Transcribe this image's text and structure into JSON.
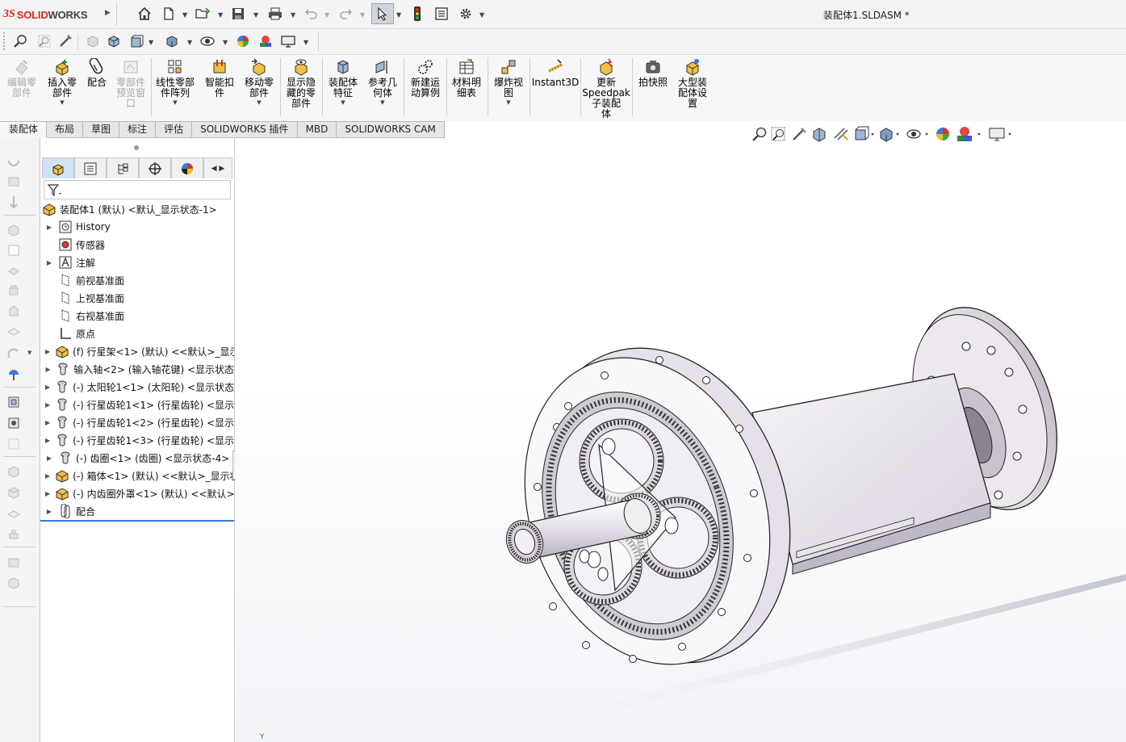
{
  "app": {
    "logo_ds": "3S",
    "logo_solid": "SOLID",
    "logo_works": "WORKS",
    "document_title": "装配体1.SLDASM *"
  },
  "colors": {
    "accent": "#d52b1e",
    "selection_blue": "#cfe3f5",
    "part_yellow": "#e8b830"
  },
  "titlebar_icons": [
    "home-icon",
    "new-file-icon",
    "open-file-icon",
    "save-icon",
    "print-icon",
    "undo-icon",
    "redo-icon",
    "select-arrow-icon",
    "traffic-light-icon",
    "file-properties-icon",
    "options-gear-icon"
  ],
  "viewbar_icons": [
    "zoom-to-fit-icon",
    "zoom-area-icon",
    "previous-view-icon",
    "section-view-icon",
    "view-orientation-icon",
    "display-style-icon",
    "hide-show-icon",
    "appearance-icon",
    "scene-icon",
    "view-settings-icon"
  ],
  "command_manager": [
    {
      "label": "编辑零\n部件",
      "disabled": true,
      "icon": "edit-component-icon"
    },
    {
      "label": "插入零\n部件",
      "disabled": false,
      "icon": "insert-component-icon"
    },
    {
      "label": "配合",
      "disabled": false,
      "icon": "mate-icon"
    },
    {
      "label": "零部件\n预览窗\n口",
      "disabled": true,
      "icon": "component-preview-icon"
    },
    {
      "label": "线性零部\n件阵列",
      "disabled": false,
      "icon": "linear-pattern-icon"
    },
    {
      "label": "智能扣\n件",
      "disabled": false,
      "icon": "smart-fasteners-icon"
    },
    {
      "label": "移动零\n部件",
      "disabled": false,
      "icon": "move-component-icon"
    },
    {
      "label": "显示隐\n藏的零\n部件",
      "disabled": false,
      "icon": "show-hidden-icon"
    },
    {
      "label": "装配体\n特征",
      "disabled": false,
      "icon": "assembly-features-icon"
    },
    {
      "label": "参考几\n何体",
      "disabled": false,
      "icon": "reference-geometry-icon"
    },
    {
      "label": "新建运\n动算例",
      "disabled": false,
      "icon": "motion-study-icon"
    },
    {
      "label": "材料明\n细表",
      "disabled": false,
      "icon": "bill-of-materials-icon"
    },
    {
      "label": "爆炸视\n图",
      "disabled": false,
      "icon": "exploded-view-icon"
    },
    {
      "label": "Instant3D",
      "disabled": false,
      "icon": "instant3d-icon"
    },
    {
      "label": "更新\nSpeedpak\n子装配\n体",
      "disabled": false,
      "icon": "speedpak-icon"
    },
    {
      "label": "拍快照",
      "disabled": false,
      "icon": "snapshot-icon"
    },
    {
      "label": "大型装\n配体设\n置",
      "disabled": false,
      "icon": "large-assembly-icon"
    }
  ],
  "tabs": [
    "装配体",
    "布局",
    "草图",
    "标注",
    "评估",
    "SOLIDWORKS 插件",
    "MBD",
    "SOLIDWORKS CAM"
  ],
  "active_tab": "装配体",
  "feature_tree": {
    "root": "装配体1 (默认) <默认_显示状态-1>",
    "items": [
      {
        "label": "History",
        "icon": "history-icon",
        "expand": true
      },
      {
        "label": "传感器",
        "icon": "sensor-icon",
        "expand": false
      },
      {
        "label": "注解",
        "icon": "annotation-icon",
        "expand": true
      },
      {
        "label": "前视基准面",
        "icon": "plane-icon",
        "expand": false
      },
      {
        "label": "上视基准面",
        "icon": "plane-icon",
        "expand": false
      },
      {
        "label": "右视基准面",
        "icon": "plane-icon",
        "expand": false
      },
      {
        "label": "原点",
        "icon": "origin-icon",
        "expand": false
      },
      {
        "label": "(f) 行星架<1> (默认) <<默认>_显示",
        "icon": "assembly-part-icon",
        "expand": true
      },
      {
        "label": "输入轴<2> (输入轴花键) <显示状态",
        "icon": "part-icon",
        "expand": true
      },
      {
        "label": "(-) 太阳轮1<1> (太阳轮) <显示状态",
        "icon": "part-icon",
        "expand": true
      },
      {
        "label": "(-) 行星齿轮1<1> (行星齿轮) <显示",
        "icon": "part-icon",
        "expand": true
      },
      {
        "label": "(-) 行星齿轮1<2> (行星齿轮) <显示",
        "icon": "part-icon",
        "expand": true
      },
      {
        "label": "(-) 行星齿轮1<3> (行星齿轮) <显示",
        "icon": "part-icon",
        "expand": true
      },
      {
        "label": "(-) 齿圈<1> (齿圈) <显示状态-4>",
        "icon": "part-icon",
        "expand": true
      },
      {
        "label": "(-) 箱体<1> (默认) <<默认>_显示状",
        "icon": "assembly-part-icon",
        "expand": true
      },
      {
        "label": "(-) 内齿圈外罩<1> (默认) <<默认>",
        "icon": "assembly-part-icon",
        "expand": true
      },
      {
        "label": "配合",
        "icon": "mates-folder-icon",
        "expand": true
      }
    ]
  },
  "fm_tabs": [
    "feature-manager-tab-icon",
    "property-manager-tab-icon",
    "configuration-manager-tab-icon",
    "dimxpert-tab-icon",
    "display-manager-tab-icon"
  ],
  "viewport": {
    "triad_label": "Y"
  }
}
